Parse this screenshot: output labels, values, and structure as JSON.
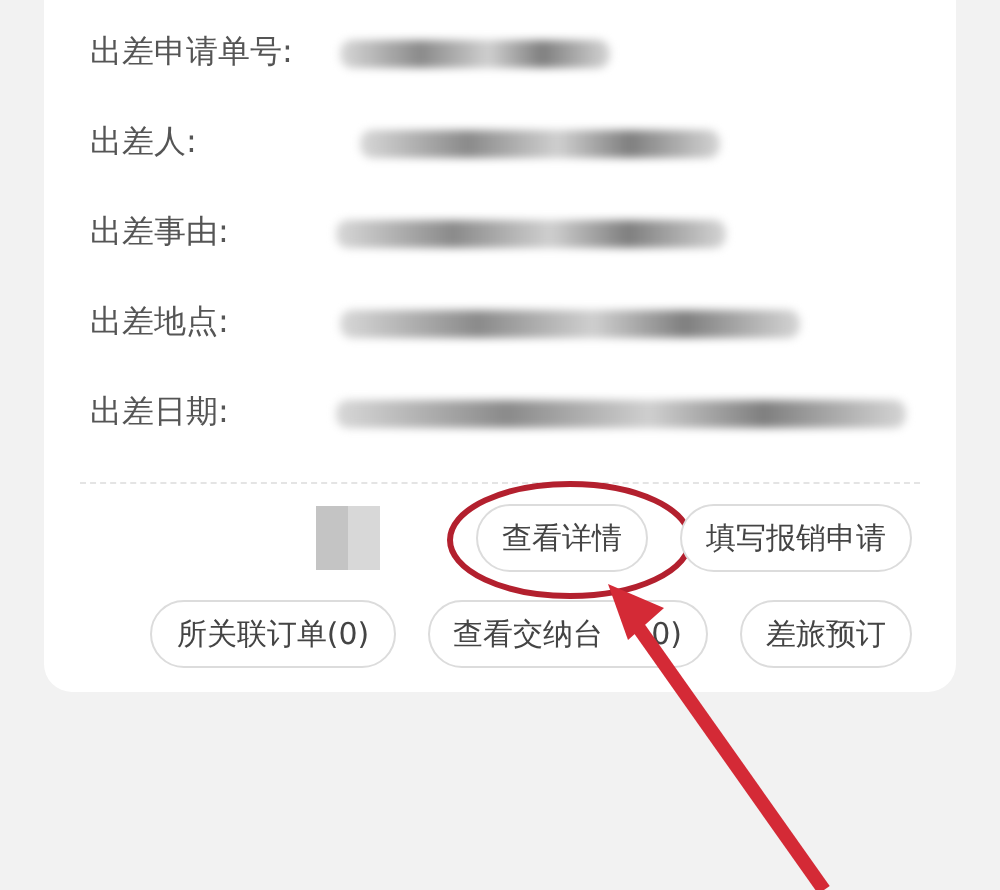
{
  "fields": [
    {
      "label": "出差申请单号:"
    },
    {
      "label": "出差人:"
    },
    {
      "label": "出差事由:"
    },
    {
      "label": "出差地点:"
    },
    {
      "label": "出差日期:"
    }
  ],
  "action_rows": [
    {
      "buttons": [
        {
          "label": "查看详情",
          "highlighted": true
        },
        {
          "label": "填写报销申请",
          "highlighted": false
        }
      ]
    },
    {
      "buttons": [
        {
          "label": "所关联订单(0)",
          "highlighted": false
        },
        {
          "label": "查看交纳台",
          "label_tail": "0)",
          "highlighted": false
        },
        {
          "label": "差旅预订",
          "highlighted": false
        }
      ]
    }
  ]
}
